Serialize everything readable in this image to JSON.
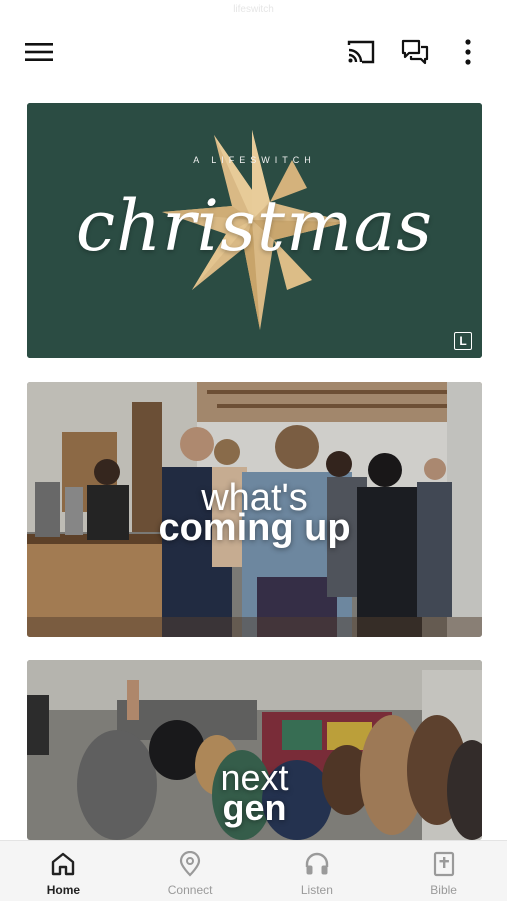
{
  "status": {
    "faint_text": "lifeswitch"
  },
  "header": {
    "menu_icon": "hamburger-menu-icon",
    "cast_icon": "cast-icon",
    "chat_icon": "chat-bubbles-icon",
    "more_icon": "more-vertical-icon"
  },
  "cards": [
    {
      "arc_text": "A LIFESWITCH",
      "title": "christmas",
      "logo_text": "L",
      "bg": "#2b4c43"
    },
    {
      "line1": "what's",
      "line2": "coming up"
    },
    {
      "line1": "next",
      "line2": "gen"
    }
  ],
  "tabbar": {
    "items": [
      {
        "label": "Home",
        "icon": "home-icon",
        "active": true
      },
      {
        "label": "Connect",
        "icon": "location-pin-icon",
        "active": false
      },
      {
        "label": "Listen",
        "icon": "headphones-icon",
        "active": false
      },
      {
        "label": "Bible",
        "icon": "bible-icon",
        "active": false
      }
    ]
  },
  "colors": {
    "accent_dark": "#222222",
    "inactive": "#9a9a9a",
    "christmas_bg": "#2b4c43"
  }
}
